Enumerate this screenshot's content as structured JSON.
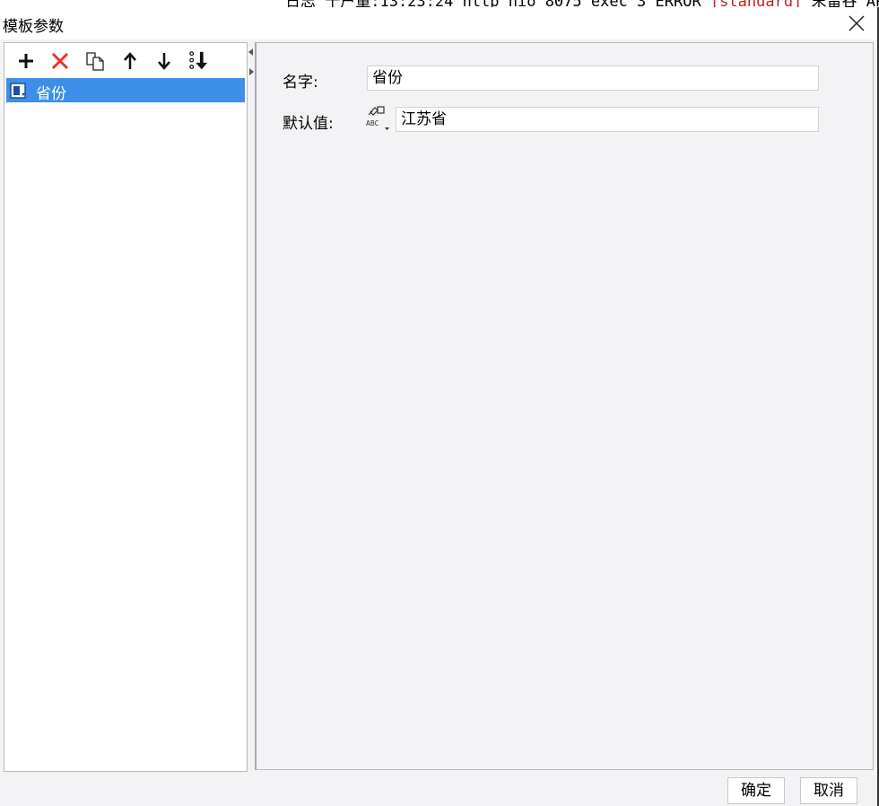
{
  "background_window": {
    "prefix": "日志 十户量:13:23:24 http nio 8075 exec 3 ERROR ",
    "highlight": "[standard]",
    "suffix": " 末留谷 API Ml"
  },
  "dialog": {
    "title": "模板参数"
  },
  "toolbar": {
    "buttons": [
      {
        "name": "add-button",
        "icon": "plus-icon"
      },
      {
        "name": "delete-button",
        "icon": "red-x-icon"
      },
      {
        "name": "copy-button",
        "icon": "copy-icon"
      },
      {
        "name": "move-up-button",
        "icon": "arrow-up-icon"
      },
      {
        "name": "move-down-button",
        "icon": "arrow-down-icon"
      },
      {
        "name": "move-to-bottom-button",
        "icon": "move-bottom-icon"
      }
    ]
  },
  "parameters": [
    {
      "label": "省份",
      "selected": true
    }
  ],
  "form": {
    "name_label": "名字:",
    "name_value": "省份",
    "default_label": "默认值:",
    "default_value": "江苏省",
    "type_icon": "string-type-icon"
  },
  "footer": {
    "ok_label": "确定",
    "cancel_label": "取消"
  },
  "colors": {
    "selection": "#3d8ee6",
    "dialog_bg": "#f3f3f5",
    "delete_red": "#e5332a"
  }
}
